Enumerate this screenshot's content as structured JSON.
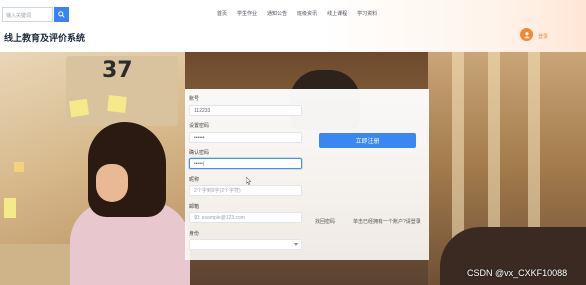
{
  "header": {
    "search": {
      "placeholder": "输入关键词"
    },
    "nav": [
      "首页",
      "学生作业",
      "通知公告",
      "班级资讯",
      "线上课程",
      "学习资料"
    ],
    "title": "线上教育及评价系统",
    "login_label": "登录"
  },
  "form": {
    "fields": [
      {
        "label": "账号",
        "value": "112233"
      },
      {
        "label": "设置密码",
        "value": "••••••"
      },
      {
        "label": "确认密码",
        "value": "•••••|"
      },
      {
        "label": "昵称",
        "placeholder": "2个字到9字(2个字符)"
      },
      {
        "label": "邮箱",
        "placeholder": "如: example@123.com"
      },
      {
        "label": "身份",
        "value": ""
      }
    ],
    "submit_label": "立即注册",
    "forgot_label": "找回密码",
    "have_account_label": "单击已经拥有一个账户?请登录"
  },
  "watermark": "CSDN @vx_CXKF10088",
  "colors": {
    "accent": "#3a86f2",
    "orange": "#f08a3a"
  }
}
